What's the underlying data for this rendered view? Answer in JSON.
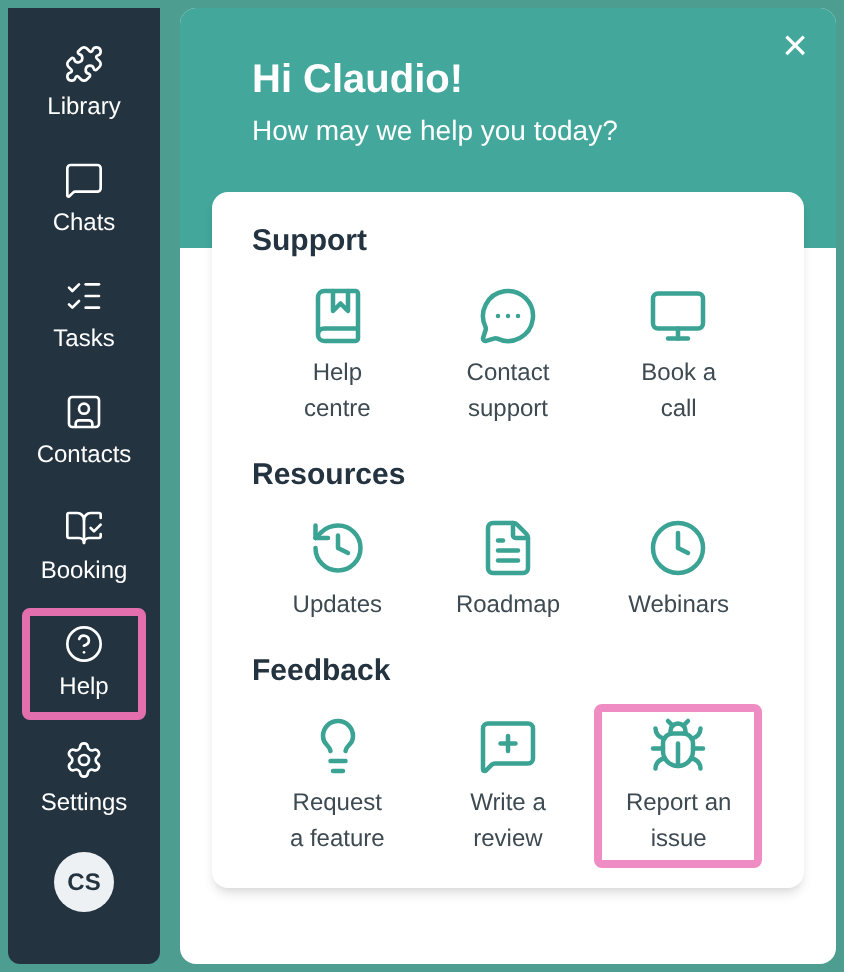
{
  "sidebar": {
    "items": [
      {
        "label": "Library",
        "highlighted": false
      },
      {
        "label": "Chats",
        "highlighted": false
      },
      {
        "label": "Tasks",
        "highlighted": false
      },
      {
        "label": "Contacts",
        "highlighted": false
      },
      {
        "label": "Booking",
        "highlighted": false
      },
      {
        "label": "Help",
        "highlighted": true
      },
      {
        "label": "Settings",
        "highlighted": false
      }
    ],
    "avatar": "CS"
  },
  "panel": {
    "close": "×",
    "greeting": "Hi Claudio!",
    "subtitle": "How may we help you today?",
    "sections": [
      {
        "title": "Support",
        "items": [
          {
            "label": "Help centre",
            "highlighted": false
          },
          {
            "label": "Contact support",
            "highlighted": false
          },
          {
            "label": "Book a call",
            "highlighted": false
          }
        ]
      },
      {
        "title": "Resources",
        "items": [
          {
            "label": "Updates",
            "highlighted": false
          },
          {
            "label": "Roadmap",
            "highlighted": false
          },
          {
            "label": "Webinars",
            "highlighted": false
          }
        ]
      },
      {
        "title": "Feedback",
        "items": [
          {
            "label": "Request a feature",
            "highlighted": false
          },
          {
            "label": "Write a review",
            "highlighted": false
          },
          {
            "label": "Report an issue",
            "highlighted": true
          }
        ]
      }
    ]
  }
}
